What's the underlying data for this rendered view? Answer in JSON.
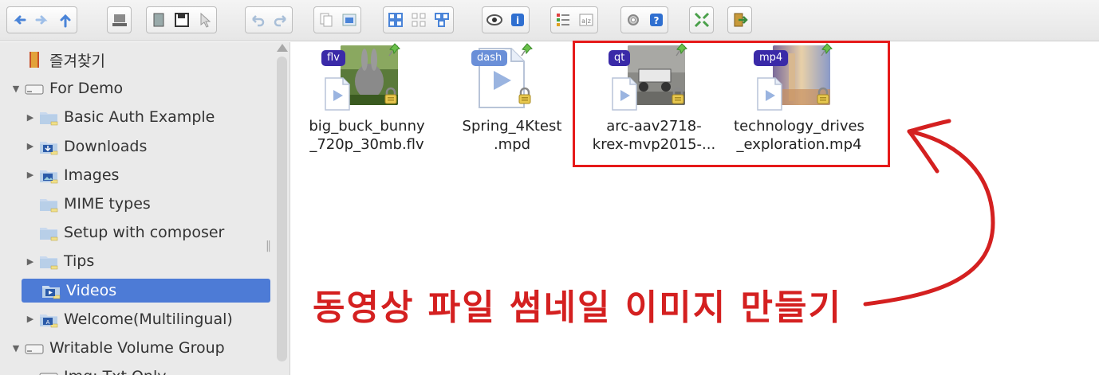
{
  "toolbar": {
    "groups": [
      [
        "back-icon",
        "forward-icon",
        "up-icon"
      ],
      [
        "reload-icon"
      ],
      [
        "open-icon",
        "save-icon",
        "select-icon"
      ],
      [
        "undo-icon",
        "redo-icon"
      ],
      [
        "copy-icon",
        "paste-icon"
      ],
      [
        "icons-view-icon",
        "list-view-icon",
        "tree-view-icon"
      ],
      [
        "preview-icon",
        "info-icon"
      ],
      [
        "details-icon",
        "sort-icon"
      ],
      [
        "settings-icon",
        "help-icon"
      ],
      [
        "fullscreen-icon"
      ],
      [
        "exit-icon"
      ]
    ],
    "colors": {
      "accent": "#2f6fd0",
      "bg": "#ececec"
    }
  },
  "sidebar": {
    "items": [
      {
        "label": "즐겨찾기",
        "level": 0,
        "arrow": "",
        "icon": "favorites-icon"
      },
      {
        "label": "For Demo",
        "level": 0,
        "arrow": "down",
        "icon": "drive-icon"
      },
      {
        "label": "Basic Auth Example",
        "level": 1,
        "arrow": "right",
        "icon": "folder-icon"
      },
      {
        "label": "Downloads",
        "level": 1,
        "arrow": "right",
        "icon": "downloads-folder-icon"
      },
      {
        "label": "Images",
        "level": 1,
        "arrow": "right",
        "icon": "images-folder-icon"
      },
      {
        "label": "MIME types",
        "level": 1,
        "arrow": "",
        "icon": "folder-icon"
      },
      {
        "label": "Setup with composer",
        "level": 1,
        "arrow": "",
        "icon": "folder-icon"
      },
      {
        "label": "Tips",
        "level": 1,
        "arrow": "right",
        "icon": "folder-icon"
      },
      {
        "label": "Videos",
        "level": 1,
        "arrow": "",
        "icon": "videos-folder-icon",
        "selected": true
      },
      {
        "label": "Welcome(Multilingual)",
        "level": 1,
        "arrow": "right",
        "icon": "welcome-folder-icon"
      },
      {
        "label": "Writable Volume Group",
        "level": 0,
        "arrow": "down",
        "icon": "drive-icon"
      },
      {
        "label": "Img: Txt Only",
        "level": 1,
        "arrow": "",
        "icon": "drive-icon"
      }
    ]
  },
  "files": [
    {
      "badge": "flv",
      "badge_color": "#3a2aa8",
      "name_lines": [
        "big_buck_bunny",
        "_720p_30mb.flv"
      ],
      "thumb": "bunny"
    },
    {
      "badge": "dash",
      "badge_color": "#6a8fd8",
      "name_lines": [
        "Spring_4Ktest",
        ".mpd"
      ],
      "thumb": "none"
    },
    {
      "badge": "qt",
      "badge_color": "#3a2aa8",
      "name_lines": [
        "arc-aav2718-",
        "krex-mvp2015-..."
      ],
      "thumb": "rover"
    },
    {
      "badge": "mp4",
      "badge_color": "#3a2aa8",
      "name_lines": [
        "technology_drives",
        "_exploration.mp4"
      ],
      "thumb": "rocket"
    }
  ],
  "annotation": {
    "text": "동영상 파일 썸네일 이미지 만들기",
    "color": "#d42020",
    "box_color": "#e61a1a"
  }
}
